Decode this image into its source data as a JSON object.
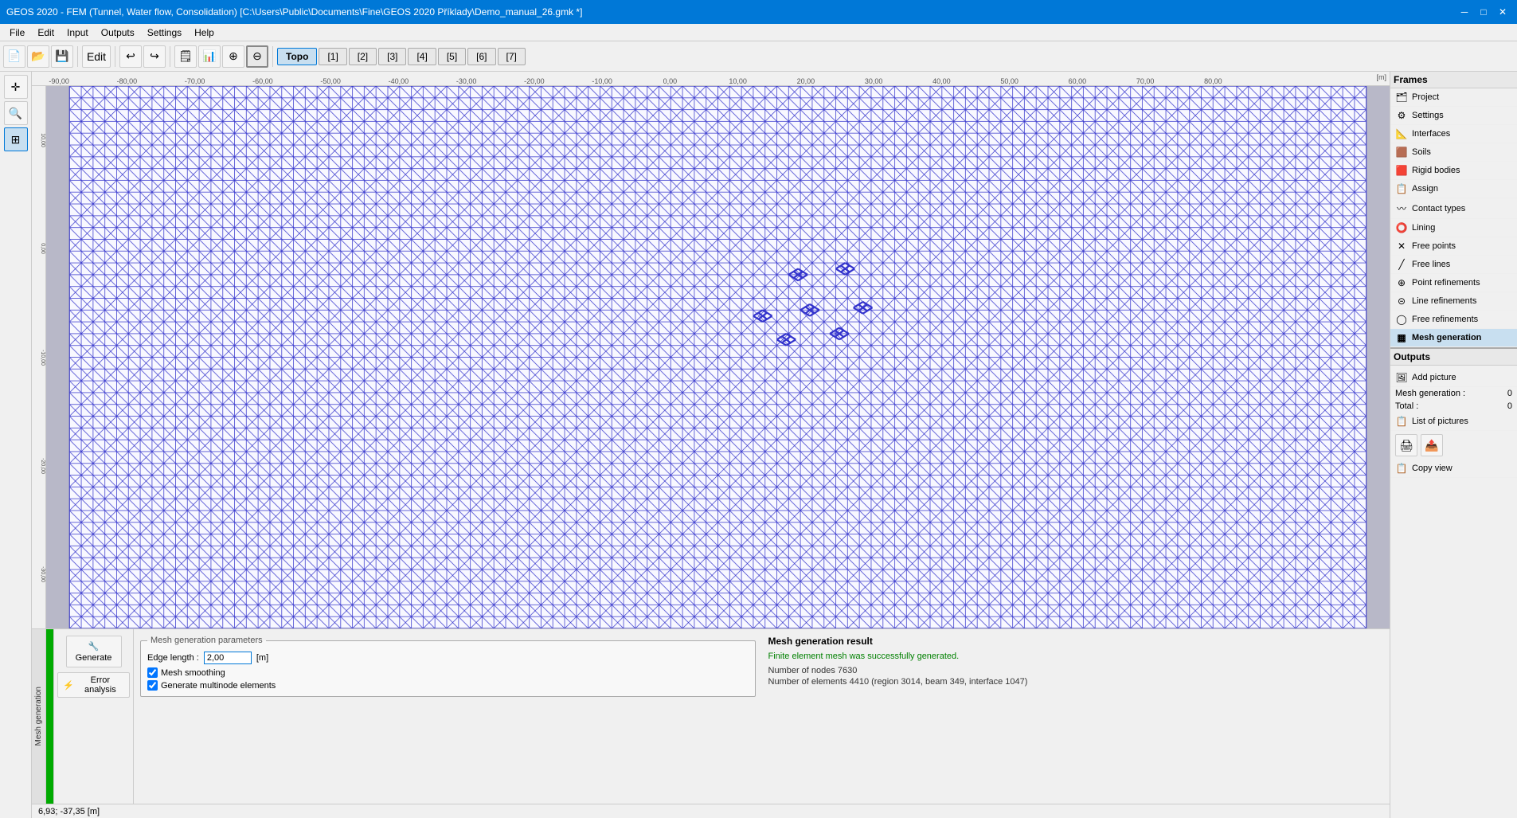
{
  "titlebar": {
    "title": "GEOS 2020 - FEM (Tunnel, Water flow, Consolidation) [C:\\Users\\Public\\Documents\\Fine\\GEOS 2020 Příklady\\Demo_manual_26.gmk *]"
  },
  "menubar": {
    "items": [
      "File",
      "Edit",
      "Input",
      "Outputs",
      "Settings",
      "Help"
    ]
  },
  "toolbar": {
    "tabs": [
      "Topo",
      "[1]",
      "[2]",
      "[3]",
      "[4]",
      "[5]",
      "[6]",
      "[7]"
    ]
  },
  "ruler": {
    "marks_h": [
      "-90,00",
      "-80,00",
      "-70,00",
      "-60,00",
      "-50,00",
      "-40,00",
      "-30,00",
      "-20,00",
      "-10,00",
      "0,00",
      "10,00",
      "20,00",
      "30,00",
      "40,00",
      "50,00",
      "60,00",
      "70,00",
      "80,00"
    ],
    "unit": "[m]",
    "marks_v": [
      "10,00",
      "0,00",
      "-10,00",
      "-20,00",
      "-30,00"
    ]
  },
  "frames_panel": {
    "title": "Frames",
    "items": [
      {
        "id": "project",
        "label": "Project",
        "icon": "🗂"
      },
      {
        "id": "settings",
        "label": "Settings",
        "icon": "⚙"
      },
      {
        "id": "interfaces",
        "label": "Interfaces",
        "icon": "📐"
      },
      {
        "id": "soils",
        "label": "Soils",
        "icon": "🟫"
      },
      {
        "id": "rigid-bodies",
        "label": "Rigid bodies",
        "icon": "🟥"
      },
      {
        "id": "assign",
        "label": "Assign",
        "icon": "📋"
      },
      {
        "id": "contact-types",
        "label": "Contact types",
        "icon": "〰"
      },
      {
        "id": "lining",
        "label": "Lining",
        "icon": "⭕"
      },
      {
        "id": "free-points",
        "label": "Free points",
        "icon": "✕"
      },
      {
        "id": "free-lines",
        "label": "Free lines",
        "icon": "╱"
      },
      {
        "id": "point-refinements",
        "label": "Point refinements",
        "icon": "⊕"
      },
      {
        "id": "line-refinements",
        "label": "Line refinements",
        "icon": "⊝"
      },
      {
        "id": "free-refinements",
        "label": "Free refinements",
        "icon": "◯"
      },
      {
        "id": "mesh-generation",
        "label": "Mesh generation",
        "icon": "▦"
      }
    ]
  },
  "outputs_panel": {
    "title": "Outputs",
    "add_picture_label": "Add picture",
    "mesh_generation_label": "Mesh generation :",
    "mesh_generation_value": "0",
    "total_label": "Total :",
    "total_value": "0",
    "list_of_pictures_label": "List of pictures",
    "copy_view_label": "Copy view"
  },
  "mesh_params": {
    "group_title": "Mesh generation parameters",
    "edge_length_label": "Edge length :",
    "edge_length_value": "2,00",
    "edge_length_unit": "[m]",
    "mesh_smoothing_label": "Mesh smoothing",
    "mesh_smoothing_checked": true,
    "multinode_label": "Generate multinode elements",
    "multinode_checked": true
  },
  "mesh_result": {
    "title": "Mesh generation result",
    "success_msg": "Finite element mesh was successfully generated.",
    "nodes_label": "Number of nodes 7630",
    "elements_label": "Number of elements 4410 (region 3014, beam 349, interface 1047)"
  },
  "bottom_toolbar": {
    "generate_label": "Generate",
    "generate_icon": "🔧",
    "error_analysis_label": "Error analysis",
    "error_icon": "⚡",
    "mesh_gen_vertical": "Mesh generation"
  },
  "statusbar": {
    "coords": "6,93; -37,35 [m]"
  }
}
